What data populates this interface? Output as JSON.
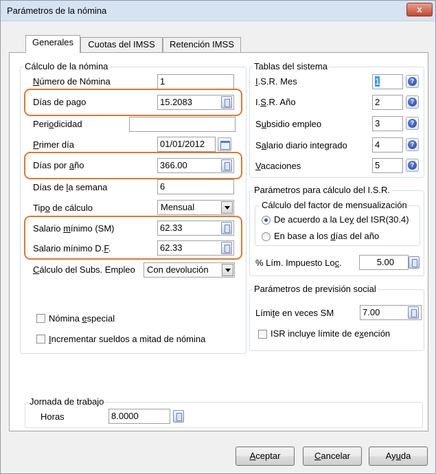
{
  "window": {
    "title": "Parámetros de la nómina",
    "close": "x"
  },
  "tabs": [
    {
      "label": "Generales"
    },
    {
      "label": "Cuotas del IMSS"
    },
    {
      "label": "Retención IMSS"
    }
  ],
  "calculo": {
    "legend": "Cálculo de la nómina",
    "numero_label": "Número de Nómina",
    "numero_value": "1",
    "dias_pago_label": "Días de pago",
    "dias_pago_value": "15.2083",
    "periodicidad_label": "Periodicidad",
    "periodicidad_value": "",
    "primer_dia_label": "Primer día",
    "primer_dia_value": "01/01/2012",
    "dias_anio_label": "Días por año",
    "dias_anio_value": "366.00",
    "dias_semana_label": "Días de la semana",
    "dias_semana_value": "6",
    "tipo_label": "Tipo de cálculo",
    "tipo_value": "Mensual",
    "sm_label": "Salario mínimo (SM)",
    "sm_value": "62.33",
    "smdf_label": "Salario mínimo D.F.",
    "smdf_value": "62.33",
    "subs_label": "Cálculo del Subs. Empleo",
    "subs_value": "Con devolución",
    "nomina_especial_label": "Nómina especial",
    "incrementar_label": "Incrementar sueldos a mitad de nómina"
  },
  "tablas": {
    "legend": "Tablas del sistema",
    "rows": [
      {
        "label": "I.S.R. Mes",
        "value": "1"
      },
      {
        "label": "I.S.R. Año",
        "value": "2"
      },
      {
        "label": "Subsidio empleo",
        "value": "3"
      },
      {
        "label": "Salario diario integrado",
        "value": "4"
      },
      {
        "label": "Vacaciones",
        "value": "5"
      }
    ]
  },
  "isr": {
    "legend": "Parámetros para cálculo del I.S.R.",
    "sub_legend": "Cálculo del factor de mensualización",
    "radio1": "De acuerdo a la Ley del ISR(30.4)",
    "radio2": "En base a los días del año",
    "lim_label": "% Lím. Impuesto Loc.",
    "lim_value": "5.00"
  },
  "prevision": {
    "legend": "Parámetros de previsión social",
    "limite_label": "Límite en veces SM",
    "limite_value": "7.00",
    "isr_check_label": "ISR incluye límite de exención"
  },
  "jornada": {
    "legend": "Jornada de trabajo",
    "horas_label": "Horas",
    "horas_value": "8.0000"
  },
  "buttons": {
    "aceptar": "Aceptar",
    "cancelar": "Cancelar",
    "ayuda": "Ayuda"
  },
  "colors": {
    "highlight": "#e0782a",
    "title_bar": "#d5e3f3",
    "close": "#c7452c"
  }
}
